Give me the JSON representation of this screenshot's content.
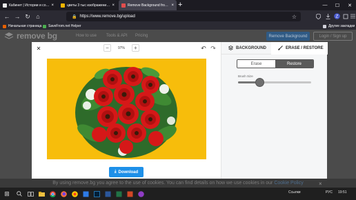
{
  "browser": {
    "tabs": [
      {
        "label": "Кабинет | Истории и событи",
        "fav_color": "#e8e8e8",
        "active": false
      },
      {
        "label": "цветы 3 тыс изображений (",
        "fav_color": "#f3b400",
        "active": false
      },
      {
        "label": "Remove Background from Ima",
        "fav_color": "#e34d4d",
        "active": true
      }
    ],
    "new_tab": "+",
    "tab_close": "×",
    "window_controls": {
      "min": "—",
      "max": "☐",
      "close": "✕"
    },
    "url": "https://www.remove.bg/upload",
    "nav_icons": {
      "back": "←",
      "forward": "→",
      "reload": "↻",
      "home": "⌂",
      "lock": "🔒",
      "star": "☆"
    },
    "toolbar_icons": [
      "shield-icon",
      "download-icon",
      "extension-icon",
      "account-icon",
      "menu-icon"
    ],
    "bookmarks": [
      {
        "label": "Начальная страница",
        "fav_color": "#e66000"
      },
      {
        "label": "SaveFrom.net Helper",
        "fav_color": "#4caf50"
      },
      {
        "label": "Другие закладки",
        "fav_color": "#cfcfd8"
      }
    ]
  },
  "site": {
    "logo": "remove bg",
    "nav": [
      "How to use",
      "Tools & API",
      "Pricing"
    ],
    "remove_background_button": "Remove Background",
    "login_button": "Login / Sign up",
    "cookie_text": "By using remove.bg you agree to the use of cookies. You can find details on how we use cookies in our",
    "cookie_link": "Cookie Policy",
    "cookie_close": "×"
  },
  "editor": {
    "close": "✕",
    "zoom_minus": "−",
    "zoom_value": "97%",
    "zoom_plus": "+",
    "undo": "↶",
    "redo": "↷",
    "download_label": "Download",
    "download_icon": "⤓",
    "tabs": [
      {
        "label": "BACKGROUND",
        "icon": "layers-icon",
        "active": false
      },
      {
        "label": "ERASE / RESTORE",
        "icon": "brush-icon",
        "active": true
      }
    ],
    "mode_erase": "Erase",
    "mode_restore": "Restore",
    "active_mode": "Restore",
    "brush_size_label": "Brush Size",
    "brush_size_fraction": 0.3,
    "canvas_bg_color": "#f7bd0b",
    "accent_color": "#1e90e8"
  },
  "taskbar": {
    "start": "⊞",
    "icons": [
      "search-icon",
      "taskview-icon",
      "explorer-icon",
      "chrome-icon",
      "firefox-icon",
      "yandex-icon",
      "app-icon",
      "photoshop-icon",
      "word-icon",
      "excel-icon",
      "powerpoint-icon",
      "media-icon"
    ],
    "links_label": "Ссылки",
    "language": "РУС",
    "time": "19:51"
  }
}
